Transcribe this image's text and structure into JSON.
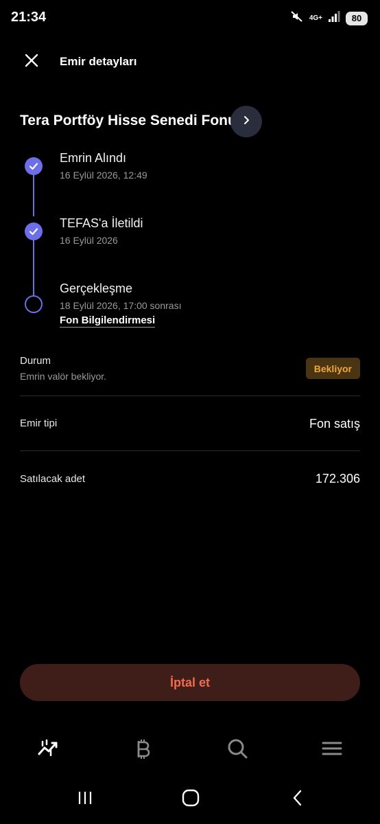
{
  "status_bar": {
    "time": "21:34",
    "network": "4G+",
    "battery": "80",
    "icons": [
      "mute-icon",
      "signal-icon",
      "battery-icon"
    ]
  },
  "header": {
    "title": "Emir detayları",
    "close_icon": "close-icon"
  },
  "fund": {
    "name": "Tera Portföy Hisse Senedi Fonu",
    "arrow_icon": "chevron-right-icon"
  },
  "timeline": {
    "steps": [
      {
        "title": "Emrin Alındı",
        "subtitle": "16 Eylül 2026, 12:49",
        "completed": true
      },
      {
        "title": "TEFAS'a İletildi",
        "subtitle": "16 Eylül 2026",
        "completed": true
      },
      {
        "title": "Gerçekleşme",
        "subtitle": "18 Eylül 2026, 17:00 sonrası",
        "completed": false
      }
    ],
    "link": "Fon Bilgilendirmesi"
  },
  "details": {
    "status_label": "Durum",
    "status_sub": "Emrin valör bekliyor.",
    "status_badge": "Bekliyor",
    "order_type_label": "Emir tipi",
    "order_type_value": "Fon satış",
    "quantity_label": "Satılacak adet",
    "quantity_value": "172.306"
  },
  "actions": {
    "cancel_label": "İptal et"
  },
  "bottom_nav": {
    "items": [
      "chart-trend-icon",
      "bitcoin-icon",
      "search-icon",
      "menu-icon"
    ]
  },
  "system_nav": {
    "items": [
      "recent-apps-icon",
      "home-icon",
      "back-icon"
    ]
  },
  "colors": {
    "accent": "#6d6fe8",
    "badge_bg": "#4a3412",
    "badge_text": "#f0a640",
    "cancel_bg": "#3f1d18",
    "cancel_text": "#f26a4f"
  }
}
